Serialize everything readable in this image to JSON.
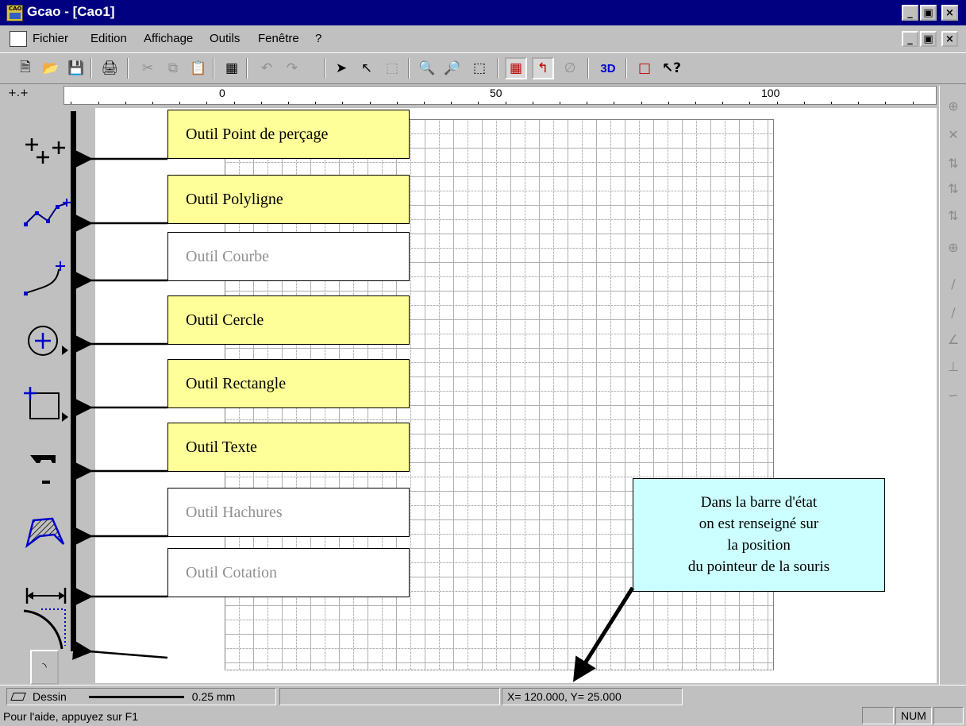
{
  "window": {
    "title": "Gcao - [Cao1]",
    "app_icon": "cad-app-icon",
    "controls": {
      "minimize": "_",
      "maximize": "Θ",
      "close": "×"
    }
  },
  "menu": {
    "items": [
      "Fichier",
      "Edition",
      "Affichage",
      "Outils",
      "Fenêtre",
      "?"
    ]
  },
  "toolbar": {
    "three_d_label": "3D",
    "help_label": "↖?"
  },
  "ruler": {
    "labels": [
      "0",
      "50",
      "100"
    ],
    "corner": "+.+"
  },
  "callouts": {
    "point": "Outil Point de perçage",
    "polyline": "Outil Polyligne",
    "curve": "Outil Courbe",
    "circle": "Outil Cercle",
    "rectangle": "Outil Rectangle",
    "text": "Outil Texte",
    "hatch": "Outil Hachures",
    "dimension": "Outil Cotation"
  },
  "info_box": {
    "line1": "Dans la barre d'état",
    "line2": "on est renseigné sur",
    "line3": "la position",
    "line4": "du pointeur de la souris"
  },
  "status": {
    "layer": "Dessin",
    "line_width": "0.25 mm",
    "coords": "X=  120.000, Y=   25.000",
    "help_text": "Pour l'aide, appuyez sur F1",
    "num": "NUM"
  },
  "colors": {
    "title_bar": "#000080",
    "callout_yellow": "#ffff99",
    "info_cyan": "#ccffff",
    "tool_blue": "#0000cc"
  }
}
